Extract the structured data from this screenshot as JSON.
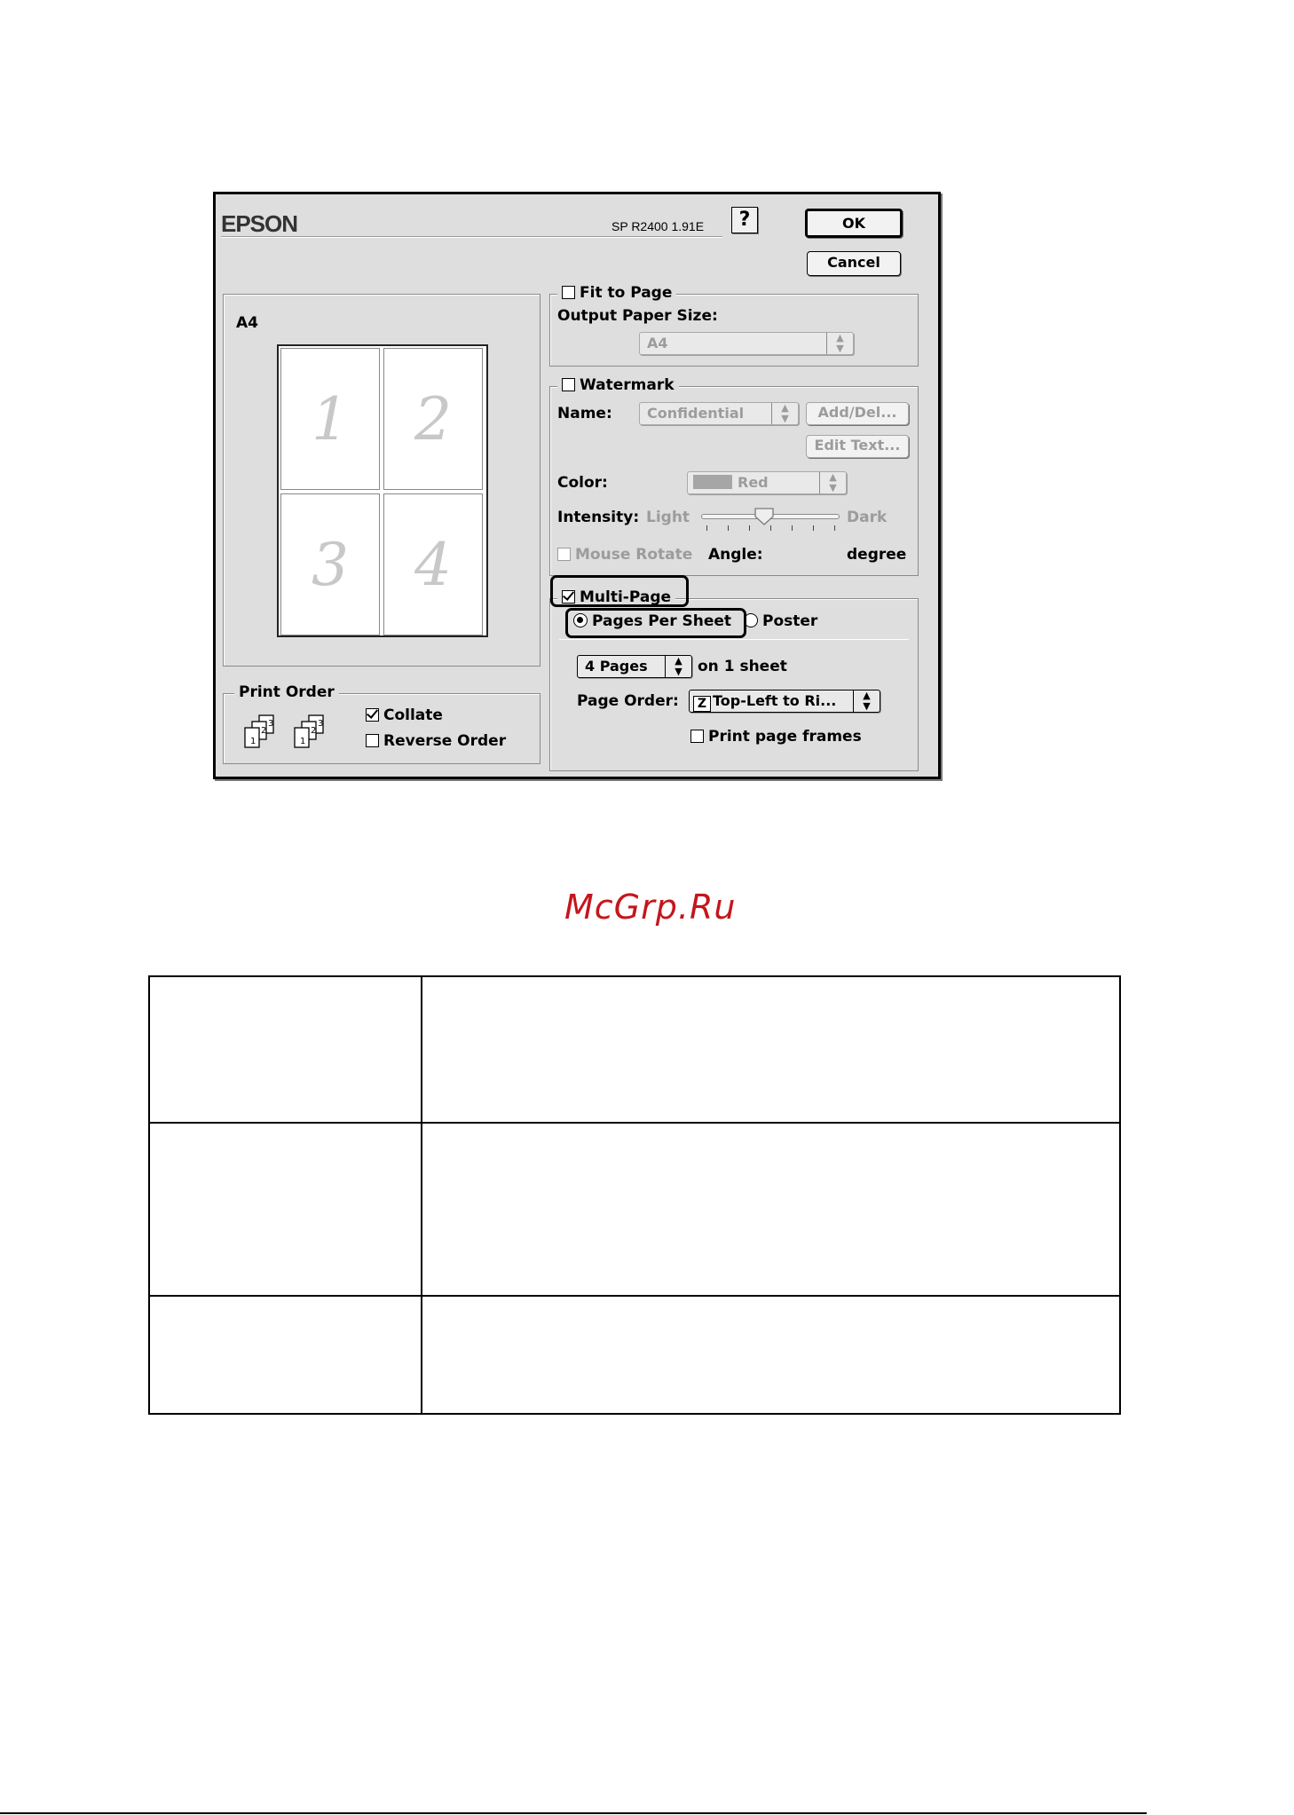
{
  "dialog": {
    "brand": "EPSON",
    "version": "SP R2400 1.91E",
    "help_label": "?",
    "ok_label": "OK",
    "cancel_label": "Cancel",
    "preview": {
      "paper_label": "A4",
      "cells": [
        "1",
        "2",
        "3",
        "4"
      ]
    },
    "print_order": {
      "legend": "Print Order",
      "collate_label": "Collate",
      "collate_checked": true,
      "reverse_label": "Reverse Order",
      "reverse_checked": false
    },
    "fit_to_page": {
      "label": "Fit to Page",
      "checked": false,
      "output_size_label": "Output Paper Size:",
      "output_size_value": "A4"
    },
    "watermark": {
      "label": "Watermark",
      "checked": false,
      "name_label": "Name:",
      "name_value": "Confidential",
      "add_del_label": "Add/Del...",
      "edit_text_label": "Edit Text...",
      "color_label": "Color:",
      "color_value": "Red",
      "intensity_label": "Intensity:",
      "light_label": "Light",
      "dark_label": "Dark",
      "intensity_level": 0.45,
      "mouse_rotate_label": "Mouse Rotate",
      "angle_label": "Angle:",
      "degree_label": "degree"
    },
    "multi_page": {
      "label": "Multi-Page",
      "checked": true,
      "pages_per_sheet_label": "Pages Per Sheet",
      "poster_label": "Poster",
      "pages_value": "4 Pages",
      "on_sheet_label": "on 1 sheet",
      "page_order_label": "Page Order:",
      "page_order_value": "Top-Left to Ri...",
      "print_frames_label": "Print page frames",
      "print_frames_checked": false
    }
  },
  "site_logo": "McGrp.Ru",
  "colors": {
    "dialog_bg": "#dedede",
    "logo_red": "#c4161c"
  }
}
